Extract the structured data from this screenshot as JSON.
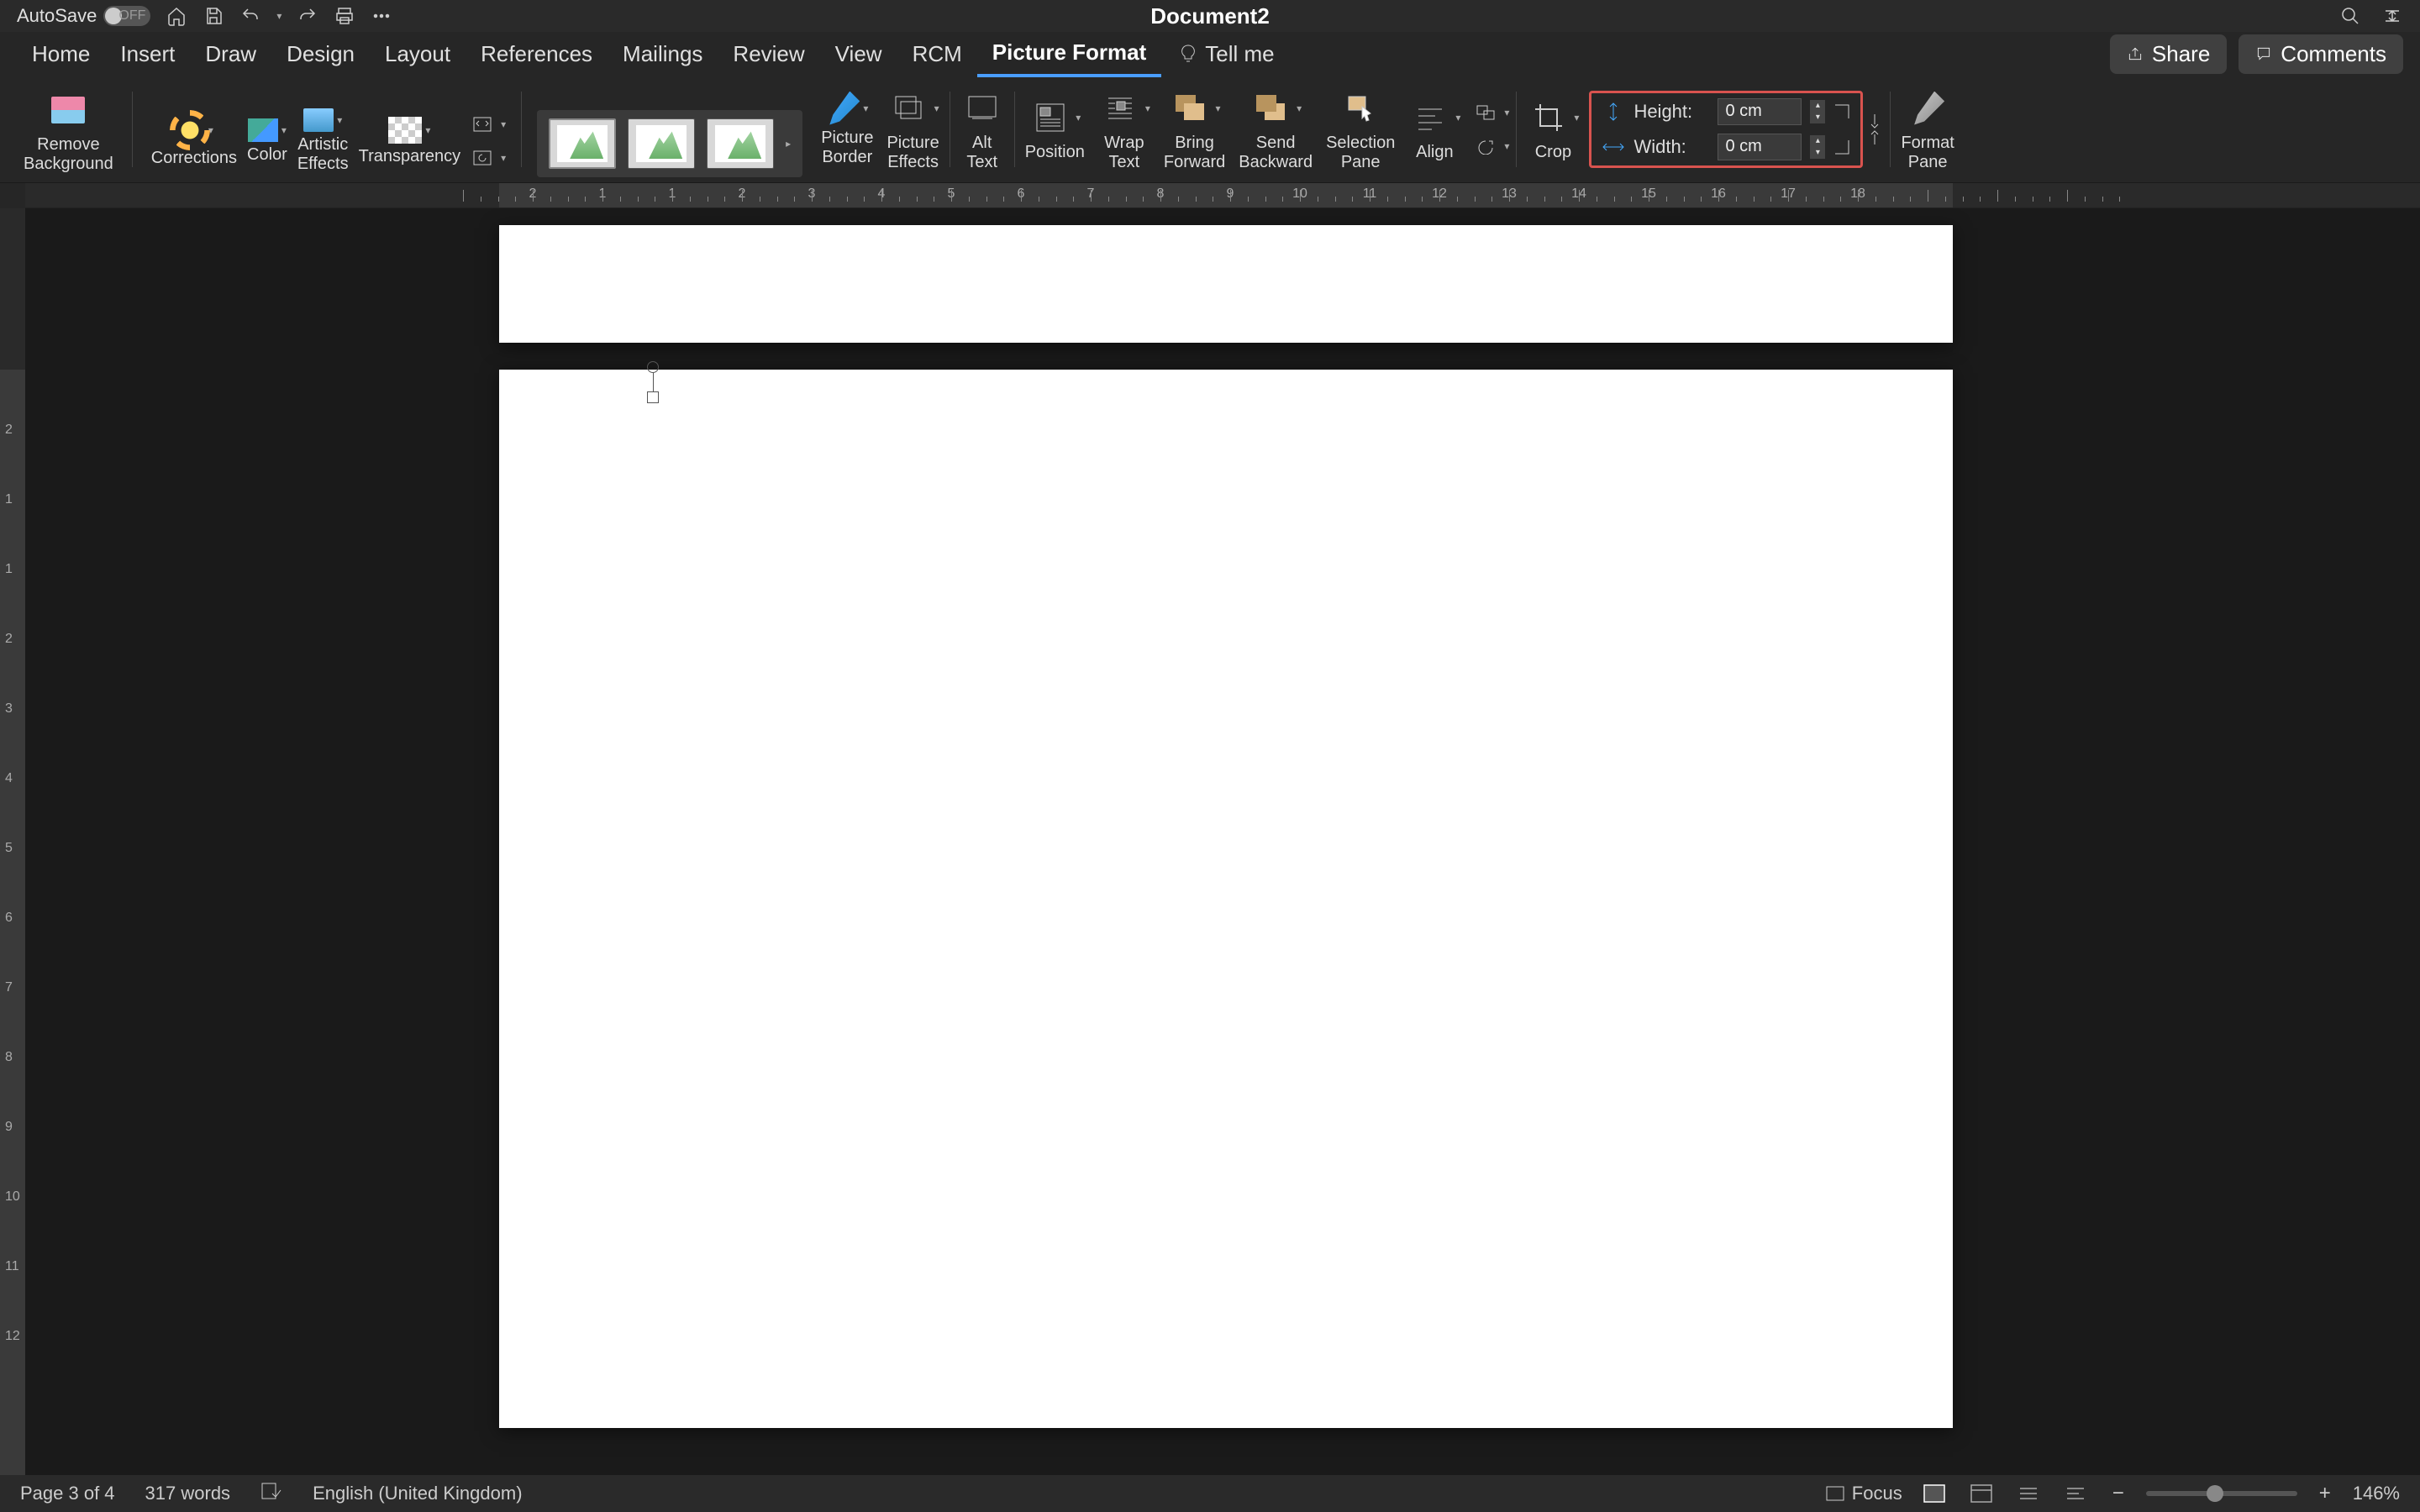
{
  "titlebar": {
    "autosave_label": "AutoSave",
    "autosave_state": "OFF",
    "doc_title": "Document2"
  },
  "tabs": {
    "items": [
      "Home",
      "Insert",
      "Draw",
      "Design",
      "Layout",
      "References",
      "Mailings",
      "Review",
      "View",
      "RCM",
      "Picture Format"
    ],
    "active": "Picture Format",
    "tell_me": "Tell me",
    "share": "Share",
    "comments": "Comments"
  },
  "ribbon": {
    "remove_bg": "Remove\nBackground",
    "corrections": "Corrections",
    "color": "Color",
    "artistic": "Artistic\nEffects",
    "transparency": "Transparency",
    "picture_border": "Picture\nBorder",
    "picture_effects": "Picture\nEffects",
    "alt_text": "Alt\nText",
    "position": "Position",
    "wrap_text": "Wrap\nText",
    "bring_forward": "Bring\nForward",
    "send_backward": "Send\nBackward",
    "selection_pane": "Selection\nPane",
    "align": "Align",
    "crop": "Crop",
    "format_pane": "Format\nPane",
    "height_label": "Height:",
    "width_label": "Width:",
    "height_value": "0 cm",
    "width_value": "0 cm"
  },
  "ruler": {
    "h_numbers": [
      2,
      1,
      1,
      2,
      3,
      4,
      5,
      6,
      7,
      8,
      9,
      10,
      11,
      12,
      13,
      14,
      15,
      16,
      17,
      18
    ],
    "v_numbers": [
      2,
      1,
      1,
      2,
      3,
      4,
      5,
      6,
      7,
      8,
      9,
      10,
      11,
      12
    ]
  },
  "statusbar": {
    "page": "Page 3 of 4",
    "words": "317 words",
    "language": "English (United Kingdom)",
    "focus": "Focus",
    "zoom": "146%"
  }
}
